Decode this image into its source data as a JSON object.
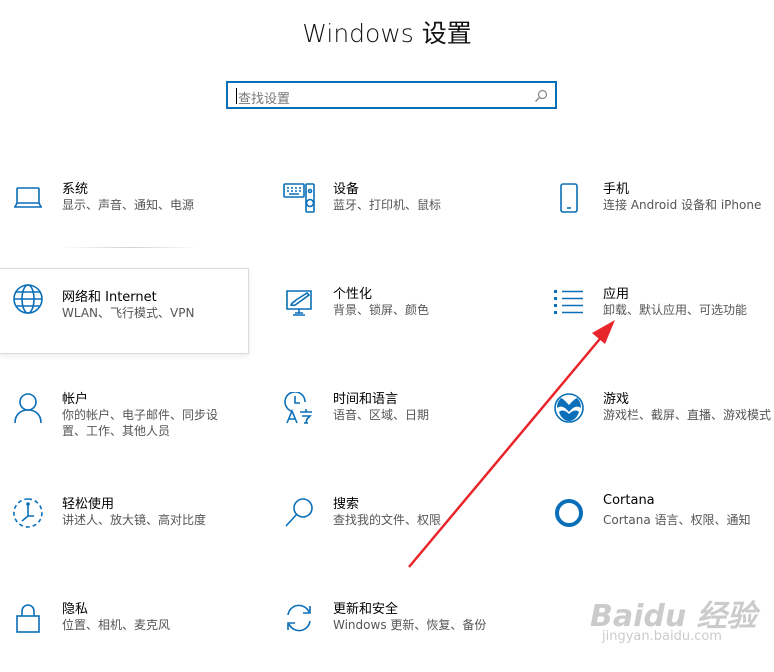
{
  "window": {
    "title": "Windows 设置"
  },
  "search": {
    "placeholder": "查找设置"
  },
  "tiles": [
    {
      "name": "系统",
      "desc": "显示、声音、通知、电源",
      "icon": "laptop-icon"
    },
    {
      "name": "设备",
      "desc": "蓝牙、打印机、鼠标",
      "icon": "keyboard-speaker-icon"
    },
    {
      "name": "手机",
      "desc": "连接 Android 设备和 iPhone",
      "icon": "phone-icon"
    },
    {
      "name": "网络和 Internet",
      "desc": "WLAN、飞行模式、VPN",
      "icon": "globe-icon"
    },
    {
      "name": "个性化",
      "desc": "背景、锁屏、颜色",
      "icon": "paintbrush-icon"
    },
    {
      "name": "应用",
      "desc": "卸载、默认应用、可选功能",
      "icon": "app-list-icon"
    },
    {
      "name": "帐户",
      "desc": "你的帐户、电子邮件、同步设置、工作、其他人员",
      "icon": "person-icon"
    },
    {
      "name": "时间和语言",
      "desc": "语音、区域、日期",
      "icon": "clock-language-icon"
    },
    {
      "name": "游戏",
      "desc": "游戏栏、截屏、直播、游戏模式",
      "icon": "xbox-icon"
    },
    {
      "name": "轻松使用",
      "desc": "讲述人、放大镜、高对比度",
      "icon": "ease-of-access-icon"
    },
    {
      "name": "搜索",
      "desc": "查找我的文件、权限",
      "icon": "magnifier-icon"
    },
    {
      "name": "Cortana",
      "desc": "Cortana 语言、权限、通知",
      "icon": "cortana-circle-icon"
    },
    {
      "name": "隐私",
      "desc": "位置、相机、麦克风",
      "icon": "lock-icon"
    },
    {
      "name": "更新和安全",
      "desc": "Windows 更新、恢复、备份",
      "icon": "refresh-icon"
    }
  ],
  "watermark": {
    "main": "Baidu 经验",
    "sub": "jingyan.baidu.com"
  },
  "colors": {
    "accent": "#0a6fb8",
    "annotation_arrow": "#e8252b"
  }
}
